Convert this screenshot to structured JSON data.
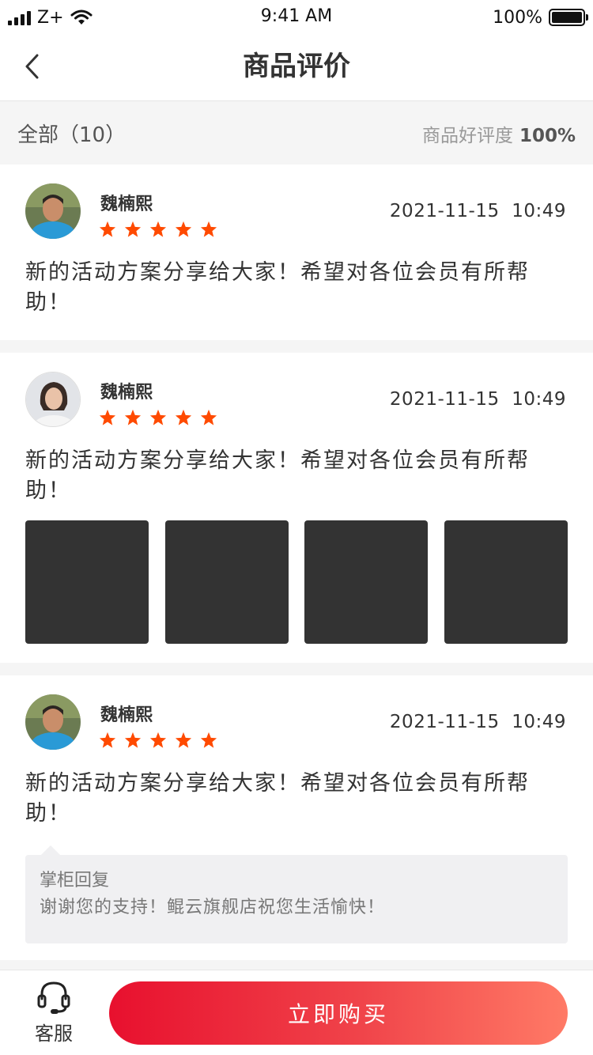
{
  "status_bar": {
    "carrier": "Z+",
    "time": "9:41 AM",
    "battery": "100%"
  },
  "nav": {
    "title": "商品评价"
  },
  "filter": {
    "all_label": "全部（10）",
    "rating_label": "商品好评度",
    "rating_value": "100%"
  },
  "reviews": [
    {
      "name": "魏楠熙",
      "rating": 5,
      "time": "2021-11-15  10:49",
      "text": "新的活动方案分享给大家！希望对各位会员有所帮助！"
    },
    {
      "name": "魏楠熙",
      "rating": 5,
      "time": "2021-11-15  10:49",
      "text": "新的活动方案分享给大家！希望对各位会员有所帮助！",
      "photos": 4
    },
    {
      "name": "魏楠熙",
      "rating": 5,
      "time": "2021-11-15  10:49",
      "text": "新的活动方案分享给大家！希望对各位会员有所帮助！",
      "reply": {
        "label": "掌柜回复",
        "text": "谢谢您的支持！鲲云旗舰店祝您生活愉快！"
      }
    }
  ],
  "bottom": {
    "service_label": "客服",
    "buy_label": "立即购买"
  },
  "colors": {
    "star": "#ff4a00",
    "buy_start": "#e8102e",
    "buy_end": "#ff7a66"
  },
  "icons": {
    "back": "chevron-left-icon",
    "service": "headset-icon",
    "star": "star-icon"
  }
}
